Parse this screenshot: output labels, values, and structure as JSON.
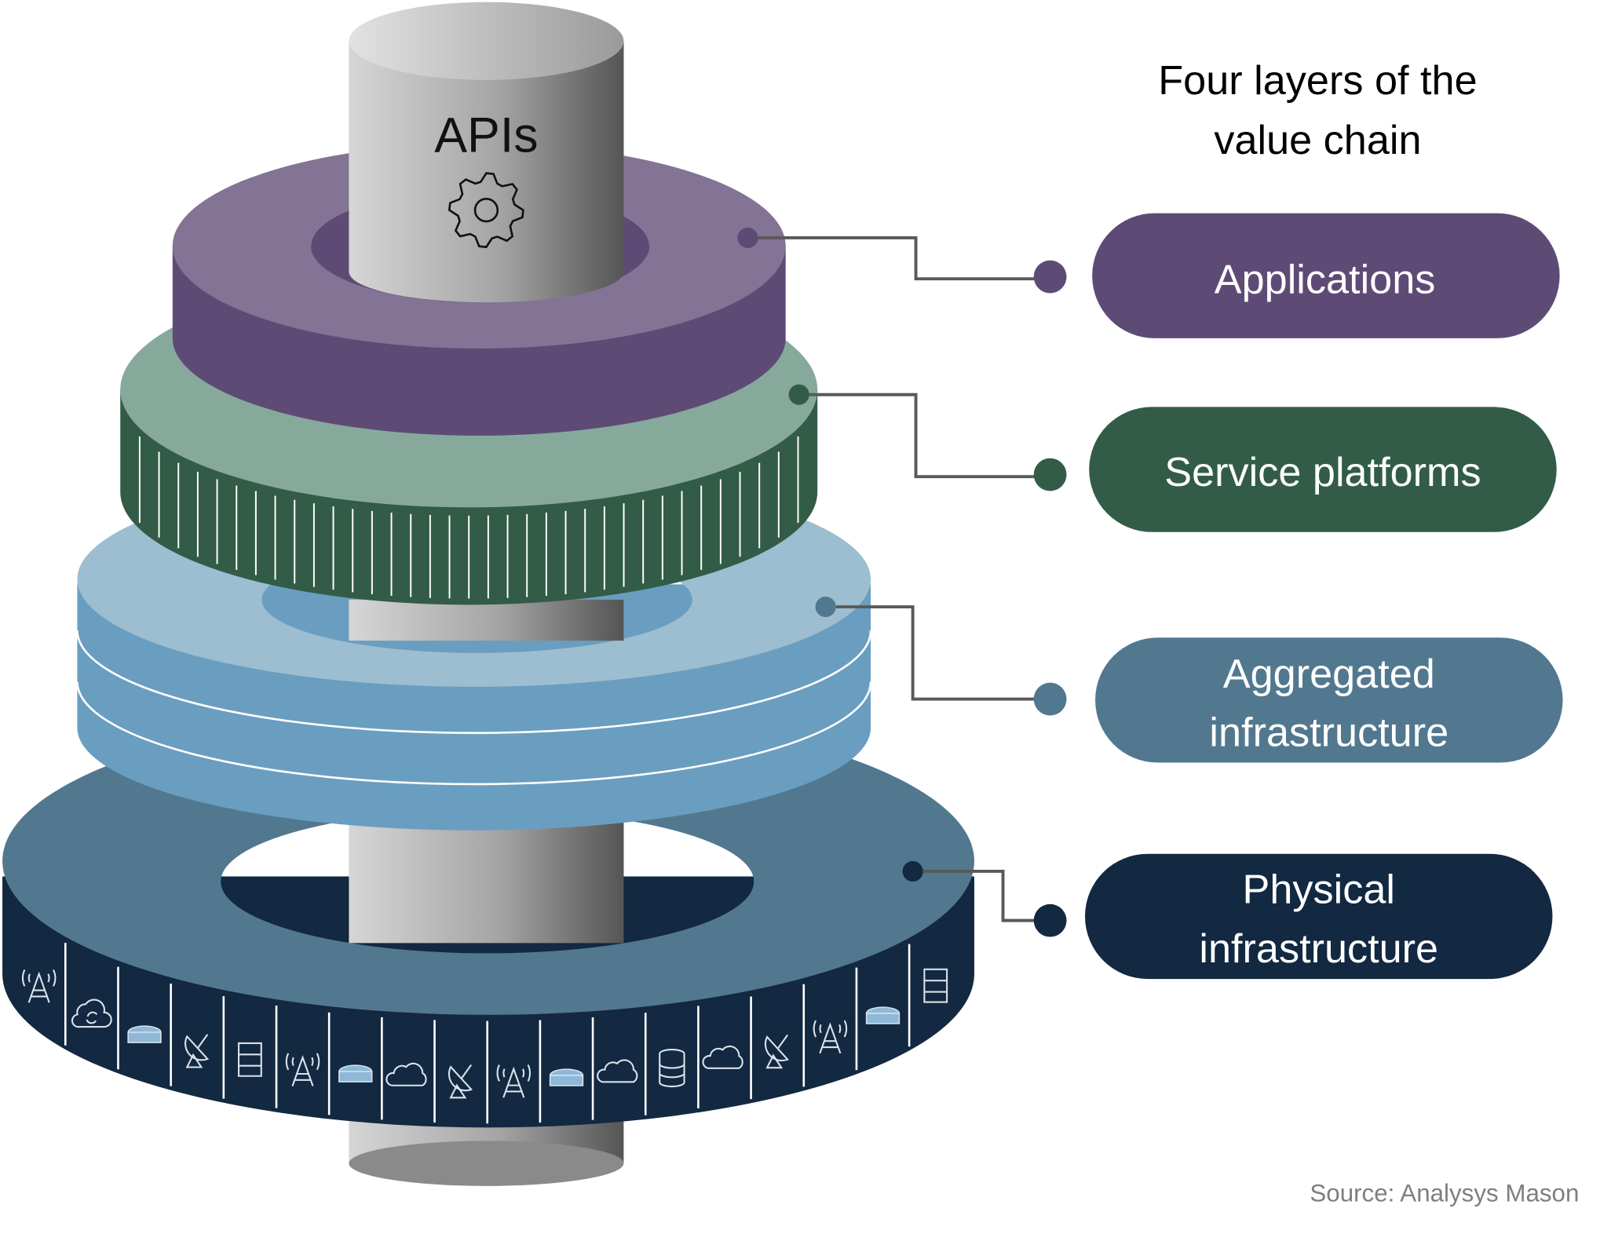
{
  "title": {
    "line1": "Four layers of the",
    "line2": "value chain"
  },
  "core": {
    "label": "APIs",
    "icon": "gear-icon"
  },
  "layers": [
    {
      "id": "applications",
      "lines": [
        "Applications"
      ],
      "color": "#5e4b75",
      "ring_top_color": "#837394"
    },
    {
      "id": "service-platforms",
      "lines": [
        "Service platforms"
      ],
      "color": "#325c47",
      "ring_top_color": "#86a99c"
    },
    {
      "id": "aggregated-infrastructure",
      "lines": [
        "Aggregated",
        "infrastructure"
      ],
      "color": "#52788f",
      "ring_top_color": "#9dbdd0",
      "ring_side_color": "#6a9ec0"
    },
    {
      "id": "physical-infrastructure",
      "lines": [
        "Physical",
        "infrastructure"
      ],
      "color": "#132841",
      "ring_top_color": "#52788f"
    }
  ],
  "physical_ring_icons": [
    "cell-tower-icon",
    "cloud-sync-icon",
    "router-icon",
    "satellite-dish-icon",
    "server-icon",
    "cell-tower-icon",
    "router-icon",
    "cloud-icon",
    "satellite-dish-icon",
    "cell-tower-icon",
    "router-icon",
    "cloud-icon",
    "database-icon",
    "cloud-icon",
    "satellite-dish-icon",
    "cell-tower-icon",
    "router-icon",
    "server-icon"
  ],
  "source": "Source: Analysys Mason"
}
